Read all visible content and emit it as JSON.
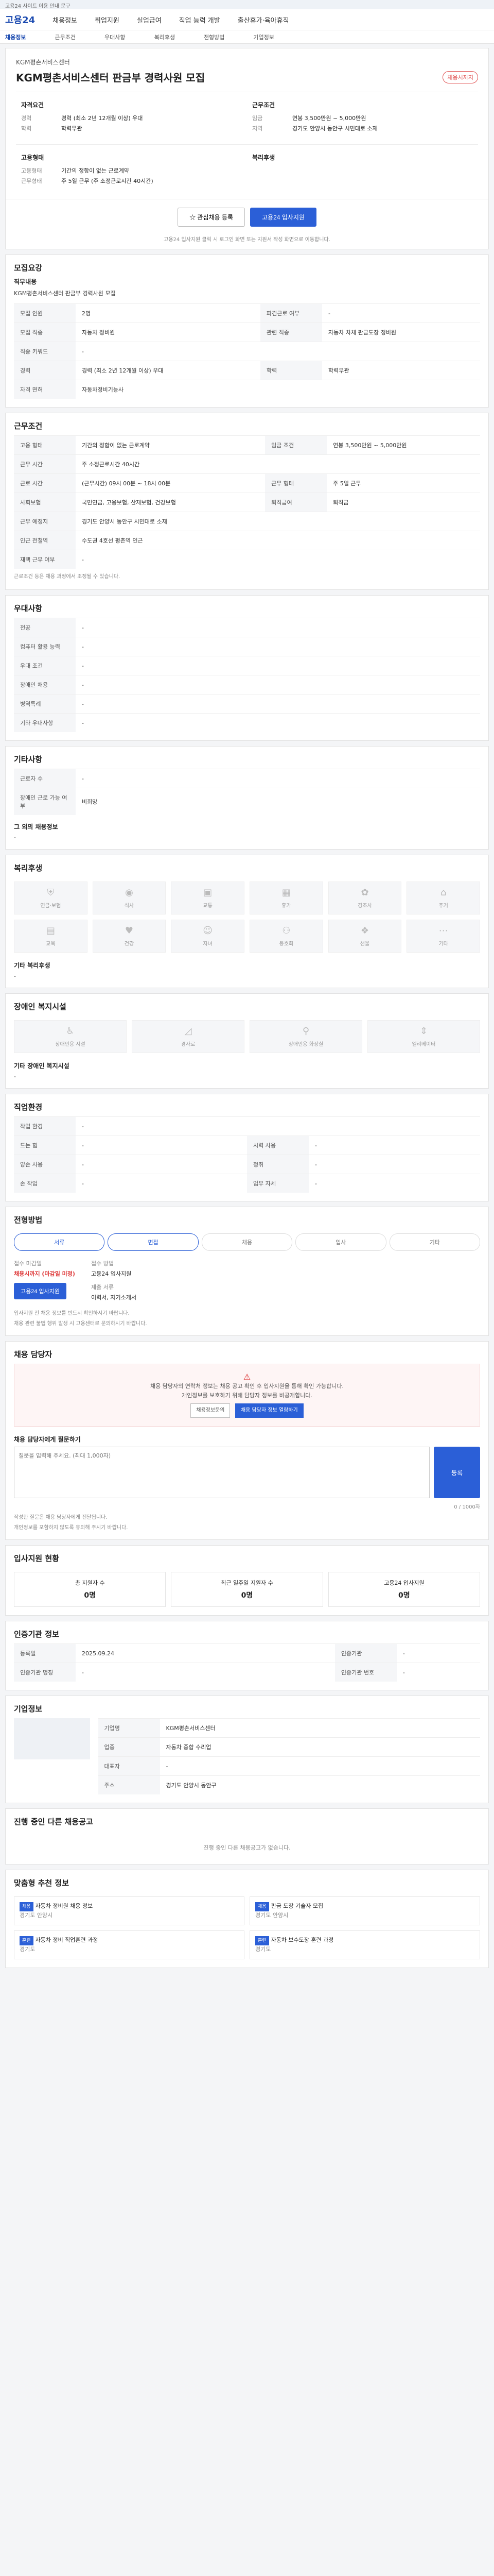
{
  "notice": "고용24 사이트 이용 안내 문구",
  "header": {
    "logo": "고용24",
    "nav": [
      "채용정보",
      "취업지원",
      "실업급여",
      "직업 능력 개발",
      "출산휴가·육아휴직"
    ],
    "subnav": [
      "채용정보",
      "근무조건",
      "우대사항",
      "복리후생",
      "전형방법",
      "기업정보"
    ]
  },
  "job": {
    "company": "KGM평촌서비스센터",
    "title": "KGM평촌서비스센터 판금부 경력사원 모집",
    "badge": "채용시까지",
    "left_title": "자격요건",
    "left": [
      {
        "k": "경력",
        "v": "경력 (최소 2년 12개월 이상) 우대"
      },
      {
        "k": "학력",
        "v": "학력무관"
      }
    ],
    "right_title": "근무조건",
    "right": [
      {
        "k": "임금",
        "v": "연봉 3,500만원 ~ 5,000만원"
      },
      {
        "k": "지역",
        "v": "경기도 안양시 동안구 시민대로 소재"
      }
    ],
    "left2_title": "고용형태",
    "left2": [
      {
        "k": "고용형태",
        "v": "기간의 정함이 없는 근로계약"
      },
      {
        "k": "근무형태",
        "v": "주 5일 근무 (주 소정근로시간 40시간)"
      }
    ],
    "right2_title": "복리후생",
    "scrap": "관심채용 등록",
    "apply": "고용24 입사지원",
    "footnote": "고용24 입사지원 클릭 시 로그인 화면 또는 지원서 작성 화면으로 이동합니다."
  },
  "qual": {
    "title": "모집요강",
    "job_desc_title": "직무내용",
    "job_desc": "KGM평촌서비스센터 판금부 경력사원 모집",
    "rows": [
      {
        "k": "모집 인원",
        "v": "2명",
        "k2": "파견근로 여부",
        "v2": "-"
      },
      {
        "k": "모집 직종",
        "v": "자동차 정비원",
        "k2": "관련 직종",
        "v2": "자동차 차체 판금도장 정비원"
      },
      {
        "k": "직종 키워드",
        "v": "-",
        "k2": "",
        "v2": ""
      },
      {
        "k": "경력",
        "v": "경력 (최소 2년 12개월 이상) 우대",
        "k2": "학력",
        "v2": "학력무관"
      },
      {
        "k": "자격 면허",
        "v": "자동차정비기능사",
        "k2": "",
        "v2": ""
      }
    ]
  },
  "cond": {
    "title": "근무조건",
    "rows": [
      {
        "k": "고용 형태",
        "v": "기간의 정함이 없는 근로계약",
        "k2": "임금 조건",
        "v2": "연봉 3,500만원 ~ 5,000만원"
      },
      {
        "k": "근무 시간",
        "v": "주 소정근로시간 40시간",
        "k2": "",
        "v2": ""
      },
      {
        "k": "근로 시간",
        "v": "(근무시간) 09시 00분 ~ 18시 00분",
        "k2": "근무 형태",
        "v2": "주 5일 근무"
      },
      {
        "k": "사회보험",
        "v": "국민연금, 고용보험, 산재보험, 건강보험",
        "k2": "퇴직급여",
        "v2": "퇴직금"
      },
      {
        "k": "근무 예정지",
        "v": "경기도 안양시 동안구 시민대로 소재",
        "k2": "",
        "v2": ""
      },
      {
        "k": "인근 전철역",
        "v": "수도권 4호선 평촌역 인근",
        "k2": "",
        "v2": ""
      },
      {
        "k": "재택 근무 여부",
        "v": "-",
        "k2": "",
        "v2": ""
      }
    ],
    "footnote": "근로조건 등은 채용 과정에서 조정될 수 있습니다."
  },
  "pref": {
    "title": "우대사항",
    "rows": [
      {
        "k": "전공",
        "v": "-"
      },
      {
        "k": "컴퓨터 활용 능력",
        "v": "-"
      },
      {
        "k": "우대 조건",
        "v": "-"
      },
      {
        "k": "장애인 채용",
        "v": "-"
      },
      {
        "k": "병역특례",
        "v": "-"
      },
      {
        "k": "기타 우대사항",
        "v": "-"
      }
    ]
  },
  "etc": {
    "title": "기타사항",
    "rows": [
      {
        "k": "근로자 수",
        "v": "-"
      },
      {
        "k": "장애인 근로 가능 여부",
        "v": "비희망"
      }
    ],
    "other_title": "그 외의 채용정보",
    "other": "-"
  },
  "welfare": {
    "title": "복리후생",
    "items": [
      "연금·보험",
      "식사",
      "교통",
      "휴가",
      "경조사",
      "주거",
      "교육",
      "건강",
      "자녀",
      "동호회",
      "선물",
      "기타"
    ],
    "other_title": "기타 복리후생",
    "other": "-"
  },
  "disability": {
    "title": "장애인 복지시설",
    "items": [
      "장애인용 시설",
      "경사로",
      "장애인용 화장실",
      "엘리베이터"
    ],
    "other_title": "기타 장애인 복지시설",
    "other": "-"
  },
  "place": {
    "title": "직업환경",
    "rows": [
      {
        "k": "작업 환경",
        "v": "-",
        "k2": "",
        "v2": ""
      },
      {
        "k": "드는 힘",
        "v": "-",
        "k2": "시력 사용",
        "v2": "-"
      },
      {
        "k": "양손 사용",
        "v": "-",
        "k2": "청취",
        "v2": "-"
      },
      {
        "k": "손 작업",
        "v": "-",
        "k2": "업무 자세",
        "v2": "-"
      }
    ]
  },
  "process": {
    "title": "전형방법",
    "steps": [
      "서류",
      "면접",
      "채용",
      "입사",
      "기타"
    ],
    "deadline_label": "접수 마감일",
    "deadline": "채용시까지 (마감일 미정)",
    "method_label": "접수 방법",
    "method": "고용24 입사지원",
    "docs_label": "제출 서류",
    "docs": "이력서, 자기소개서",
    "apply": "고용24 입사지원",
    "notes": [
      "입사지원 전 채용 정보를 반드시 확인하시기 바랍니다.",
      "채용 관련 불법 행위 발생 시 고용센터로 문의하시기 바랍니다."
    ]
  },
  "contact": {
    "title": "채용 담당자",
    "alert_line1": "채용 담당자의 연락처 정보는 채용 공고 확인 후 입사지원을 통해 확인 가능합니다.",
    "alert_line2": "개인정보를 보호하기 위해 담당자 정보를 비공개합니다.",
    "btn1": "채용정보문의",
    "btn2": "채용 담당자 정보 열람하기",
    "qa_title": "채용 담당자에게 질문하기",
    "qa_placeholder": "질문을 입력해 주세요. (최대 1,000자)",
    "qa_count": "0 / 1000자",
    "qa_btn": "등록",
    "fine": [
      "작성한 질문은 채용 담당자에게 전달됩니다.",
      "개인정보를 포함하지 않도록 유의해 주시기 바랍니다."
    ]
  },
  "stats": {
    "title": "입사지원 현황",
    "items": [
      {
        "label": "총 지원자 수",
        "value": "0명"
      },
      {
        "label": "최근 일주일 지원자 수",
        "value": "0명"
      },
      {
        "label": "고용24 입사지원",
        "value": "0명"
      }
    ]
  },
  "info": {
    "title": "인증기관 정보",
    "rows": [
      {
        "k": "등록일",
        "v": "2025.09.24",
        "k2": "인증기관",
        "v2": "-"
      },
      {
        "k": "인증기관 명칭",
        "v": "-",
        "k2": "인증기관 번호",
        "v2": "-"
      }
    ]
  },
  "company": {
    "title": "기업정보",
    "rows": [
      {
        "k": "기업명",
        "v": "KGM평촌서비스센터"
      },
      {
        "k": "업종",
        "v": "자동차 종합 수리업"
      },
      {
        "k": "대표자",
        "v": "-"
      },
      {
        "k": "주소",
        "v": "경기도 안양시 동안구"
      }
    ]
  },
  "ongoing": {
    "title": "진행 중인 다른 채용공고",
    "empty": "진행 중인 다른 채용공고가 없습니다."
  },
  "recommend": {
    "title": "맞춤형 추천 정보",
    "items": [
      {
        "tag": "채용",
        "title": "자동차 정비원 채용 정보",
        "sub": "경기도 안양시"
      },
      {
        "tag": "채용",
        "title": "판금 도장 기술자 모집",
        "sub": "경기도 안양시"
      },
      {
        "tag": "훈련",
        "title": "자동차 정비 직업훈련 과정",
        "sub": "경기도"
      },
      {
        "tag": "훈련",
        "title": "자동차 보수도장 훈련 과정",
        "sub": "경기도"
      }
    ]
  }
}
